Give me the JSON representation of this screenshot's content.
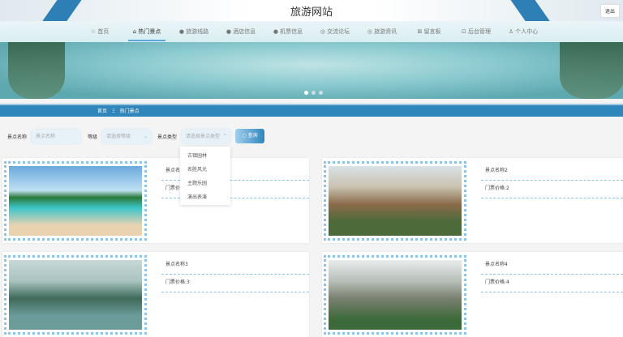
{
  "header": {
    "title": "旅游网站",
    "logout": "退出"
  },
  "nav": [
    {
      "icon": "star-icon",
      "glyph": "☆",
      "label": "首页"
    },
    {
      "icon": "home-icon",
      "glyph": "⌂",
      "label": "热门景点",
      "active": true
    },
    {
      "icon": "dot-icon",
      "glyph": "●",
      "label": "旅游线路"
    },
    {
      "icon": "dot-icon",
      "glyph": "●",
      "label": "酒店信息"
    },
    {
      "icon": "dot-icon",
      "glyph": "●",
      "label": "机票信息"
    },
    {
      "icon": "chat-icon",
      "glyph": "◎",
      "label": "交流论坛"
    },
    {
      "icon": "news-icon",
      "glyph": "◎",
      "label": "旅游资讯"
    },
    {
      "icon": "message-icon",
      "glyph": "⊠",
      "label": "留言板"
    },
    {
      "icon": "admin-icon",
      "glyph": "⊡",
      "label": "后台管理"
    },
    {
      "icon": "user-icon",
      "glyph": "♙",
      "label": "个人中心"
    }
  ],
  "breadcrumb": {
    "home": "首页",
    "sep": "Ξ",
    "current": "热门景点"
  },
  "filter": {
    "name_label": "景点名称",
    "name_placeholder": "景点名称",
    "level_label": "等级",
    "level_placeholder": "请选择等级",
    "type_label": "景点类型",
    "type_placeholder": "请选择景点类型",
    "search": "查询"
  },
  "type_options": [
    "古镇园林",
    "名胜风光",
    "主题乐园",
    "演出表演"
  ],
  "cards": [
    {
      "name": "景点名称1",
      "price": "门票价格:1"
    },
    {
      "name": "景点名称2",
      "price": "门票价格:2"
    },
    {
      "name": "景点名称3",
      "price": "门票价格:3"
    },
    {
      "name": "景点名称4",
      "price": "门票价格:4"
    }
  ]
}
